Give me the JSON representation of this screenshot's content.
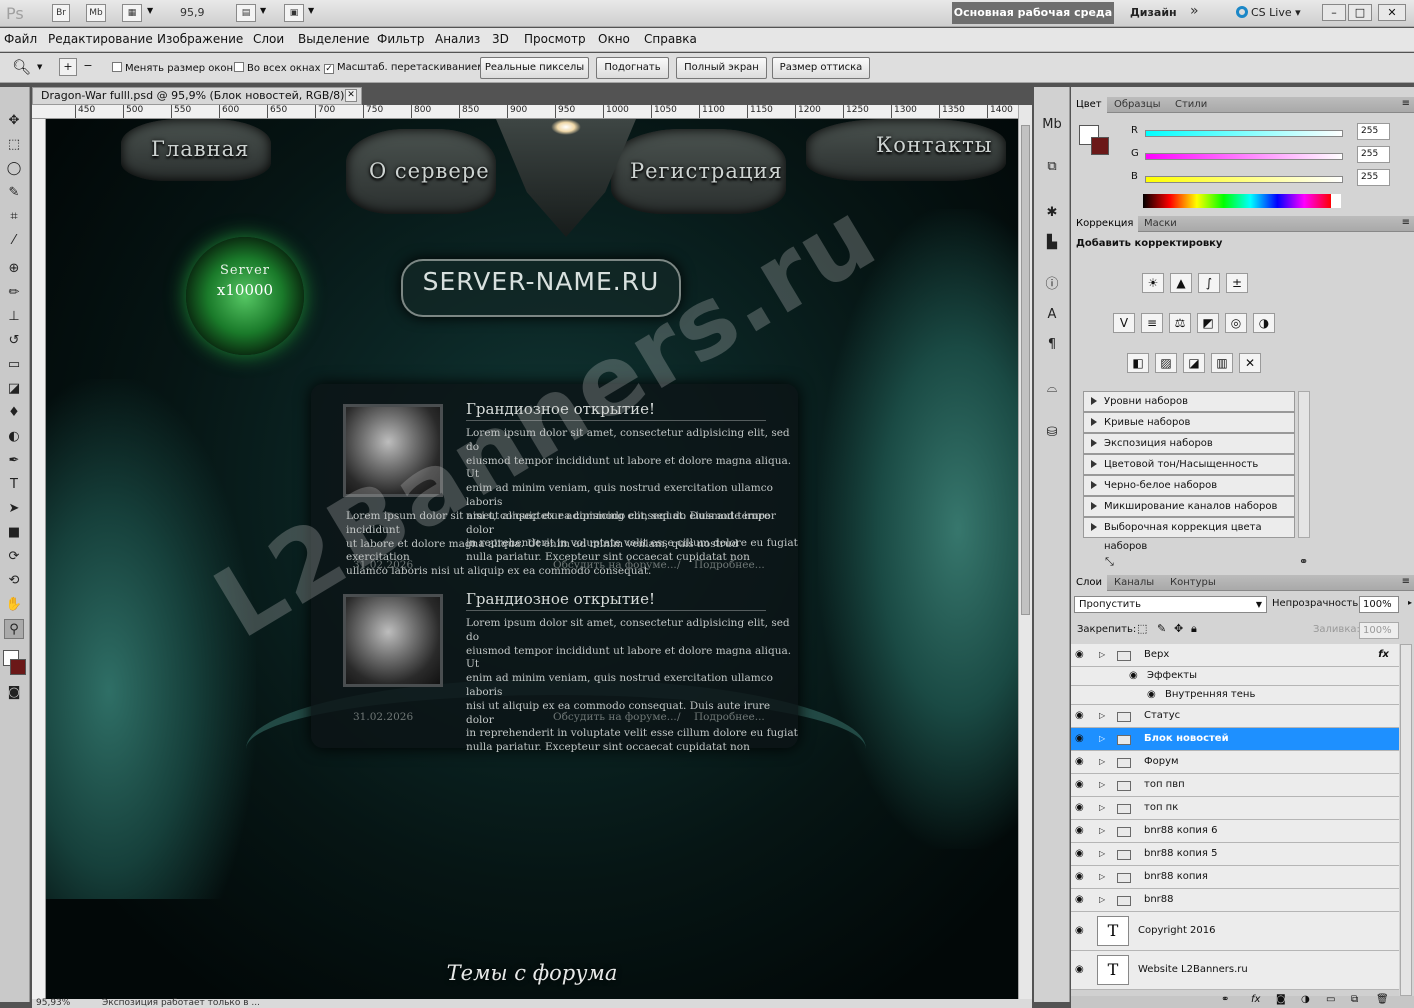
{
  "app": {
    "logo": "Ps",
    "zoom_display": "95,9",
    "workspace_active": "Основная рабочая среда",
    "workspace_design": "Дизайн",
    "cs_live": "CS Live"
  },
  "menu": [
    "Файл",
    "Редактирование",
    "Изображение",
    "Слои",
    "Выделение",
    "Фильтр",
    "Анализ",
    "3D",
    "Просмотр",
    "Окно",
    "Справка"
  ],
  "options": {
    "resize_windows": "Менять размер окон",
    "all_windows": "Во всех окнах",
    "scrubby_zoom": "Масштаб. перетаскиванием",
    "actual_pixels": "Реальные пикселы",
    "fit_screen": "Подогнать",
    "fill_screen": "Полный экран",
    "print_size": "Размер оттиска"
  },
  "document": {
    "tab_title": "Dragon-War fulll.psd @ 95,9% (Блок новостей, RGB/8) *",
    "ruler_marks": [
      "450",
      "500",
      "550",
      "600",
      "650",
      "700",
      "750",
      "800",
      "850",
      "900",
      "950",
      "1000",
      "1050",
      "1100",
      "1150",
      "1200",
      "1250",
      "1300",
      "1350",
      "1400"
    ],
    "status_zoom": "95,93%",
    "status_text": "Экспозиция работает только в ..."
  },
  "site": {
    "nav": [
      "Главная",
      "О сервере",
      "Регистрация",
      "Контакты"
    ],
    "server_label": "Server",
    "server_rate": "x10000",
    "logo_text": "SERVER-NAME.RU",
    "news": [
      {
        "title": "Грандиозное открытие!",
        "lines_right": [
          "Lorem ipsum dolor sit amet, consectetur adipisicing elit, sed do",
          "eiusmod tempor incididunt ut labore et dolore magna aliqua. Ut",
          "enim ad minim veniam, quis nostrud exercitation ullamco laboris",
          "nisi ut aliquip ex ea commodo consequat. Duis aute irure dolor",
          "in reprehenderit in voluptate velit esse cillum dolore eu fugiat",
          "nulla pariatur. Excepteur sint occaecat cupidatat non"
        ],
        "lines_full": [
          "Lorem ipsum dolor sit amet, consectetur adipisicing elit, sed do eiusmod tempor incididunt",
          "ut labore et dolore magna aliqua. Ut enim ad minim veniam, quis nostrud exercitation",
          "ullamco laboris nisi ut aliquip ex ea commodo consequat."
        ],
        "date": "31.02.2026",
        "discuss": "Обсудить на форуме...",
        "sep": "/",
        "more": "Подробнее..."
      },
      {
        "title": "Грандиозное открытие!",
        "lines_right": [
          "Lorem ipsum dolor sit amet, consectetur adipisicing elit, sed do",
          "eiusmod tempor incididunt ut labore et dolore magna aliqua. Ut",
          "enim ad minim veniam, quis nostrud exercitation ullamco laboris",
          "nisi ut aliquip ex ea commodo consequat. Duis aute irure dolor",
          "in reprehenderit in voluptate velit esse cillum dolore eu fugiat",
          "nulla pariatur. Excepteur sint occaecat cupidatat non"
        ],
        "lines_full": [],
        "date": "31.02.2026",
        "discuss": "Обсудить на форуме...",
        "sep": "/",
        "more": "Подробнее..."
      }
    ],
    "forum_title": "Темы с форума",
    "watermark": "L2Banners.ru"
  },
  "panels": {
    "color_tabs": [
      "Цвет",
      "Образцы",
      "Стили"
    ],
    "rgb": [
      {
        "label": "R",
        "value": "255"
      },
      {
        "label": "G",
        "value": "255"
      },
      {
        "label": "B",
        "value": "255"
      }
    ],
    "correction_tabs": [
      "Коррекция",
      "Маски"
    ],
    "add_correction": "Добавить корректировку",
    "presets": [
      "Уровни наборов",
      "Кривые наборов",
      "Экспозиция наборов",
      "Цветовой тон/Насыщенность наборов",
      "Черно-белое наборов",
      "Микширование каналов наборов",
      "Выборочная коррекция цвета наборов"
    ],
    "layer_tabs": [
      "Слои",
      "Каналы",
      "Контуры"
    ],
    "blend_mode": "Пропустить",
    "opacity_label": "Непрозрачность:",
    "opacity_value": "100%",
    "lock_label": "Закрепить:",
    "fill_label": "Заливка:",
    "fill_value": "100%",
    "layers": [
      {
        "name": "Верх",
        "type": "group",
        "fx": "fx"
      },
      {
        "name": "Эффекты",
        "type": "effects"
      },
      {
        "name": "Внутренняя тень",
        "type": "effect"
      },
      {
        "name": "Статус",
        "type": "group"
      },
      {
        "name": "Блок новостей",
        "type": "group",
        "selected": true
      },
      {
        "name": "Форум",
        "type": "group"
      },
      {
        "name": "топ пвп",
        "type": "group"
      },
      {
        "name": "топ пк",
        "type": "group"
      },
      {
        "name": "bnr88 копия 6",
        "type": "group"
      },
      {
        "name": "bnr88 копия 5",
        "type": "group"
      },
      {
        "name": "bnr88 копия",
        "type": "group"
      },
      {
        "name": "bnr88",
        "type": "group"
      },
      {
        "name": "Copyright  2016",
        "type": "text"
      },
      {
        "name": "Website L2Banners.ru",
        "type": "text"
      }
    ]
  },
  "colors": {
    "selection": "#1e90ff",
    "accent_green": "#2fae47",
    "workspace_bg": "#6e6e6e"
  }
}
